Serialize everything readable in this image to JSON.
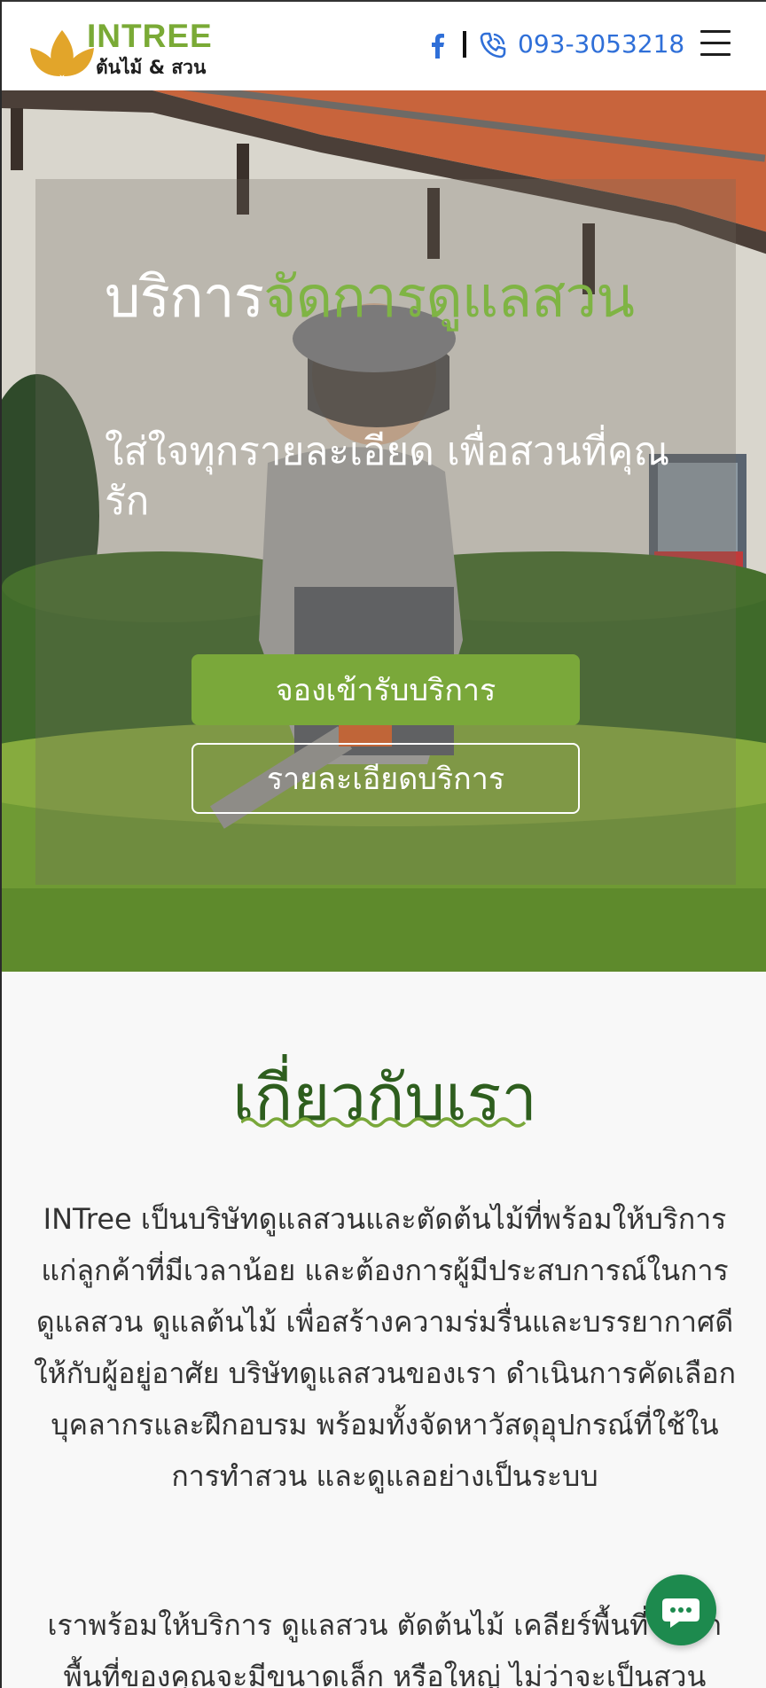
{
  "header": {
    "logo_title": "INTREE",
    "logo_subtitle": "ต้นไม้ & สวน",
    "phone": "093-3053218",
    "accent_color": "#7aaa36",
    "phone_color": "#2f6fd8",
    "icons": [
      "facebook-icon",
      "phone-icon",
      "hamburger-menu-icon"
    ]
  },
  "hero": {
    "title_plain": "บริการ",
    "title_accent": "จัดการดูแลสวน",
    "subtitle": "ใส่ใจทุกรายละเอียด เพื่อสวนที่คุณรัก",
    "book_button": "จองเข้ารับบริการ",
    "detail_button": "รายละเอียดบริการ",
    "button_color": "#7aa83a"
  },
  "about": {
    "title": "เกี่ยวกับเรา",
    "paragraph1": "INTree เป็นบริษัทดูแลสวนและตัดต้นไม้ที่พร้อมให้บริการแก่ลูกค้าที่มีเวลาน้อย และต้องการผู้มีประสบการณ์ในการดูแลสวน ดูแลต้นไม้ เพื่อสร้างความร่มรื่นและบรรยากาศดีให้กับผู้อยู่อาศัย บริษัทดูแลสวนของเรา ดำเนินการคัดเลือกบุคลากรและฝึกอบรม พร้อมทั้งจัดหาวัสดุอุปกรณ์ที่ใช้ในการทำสวน และดูแลอย่างเป็นระบบ",
    "paragraph2": "เราพร้อมให้บริการ ดูแลสวน ตัดต้นไม้ เคลียร์พื้นที่ ไม่ว่าพื้นที่ของคุณจะมีขนาดเล็ก หรือใหญ่ ไม่ว่าจะเป็นสวน",
    "title_color": "#2e5e1e"
  },
  "chat": {
    "icon": "chat-bubble-icon",
    "color": "#1d8a4e"
  }
}
